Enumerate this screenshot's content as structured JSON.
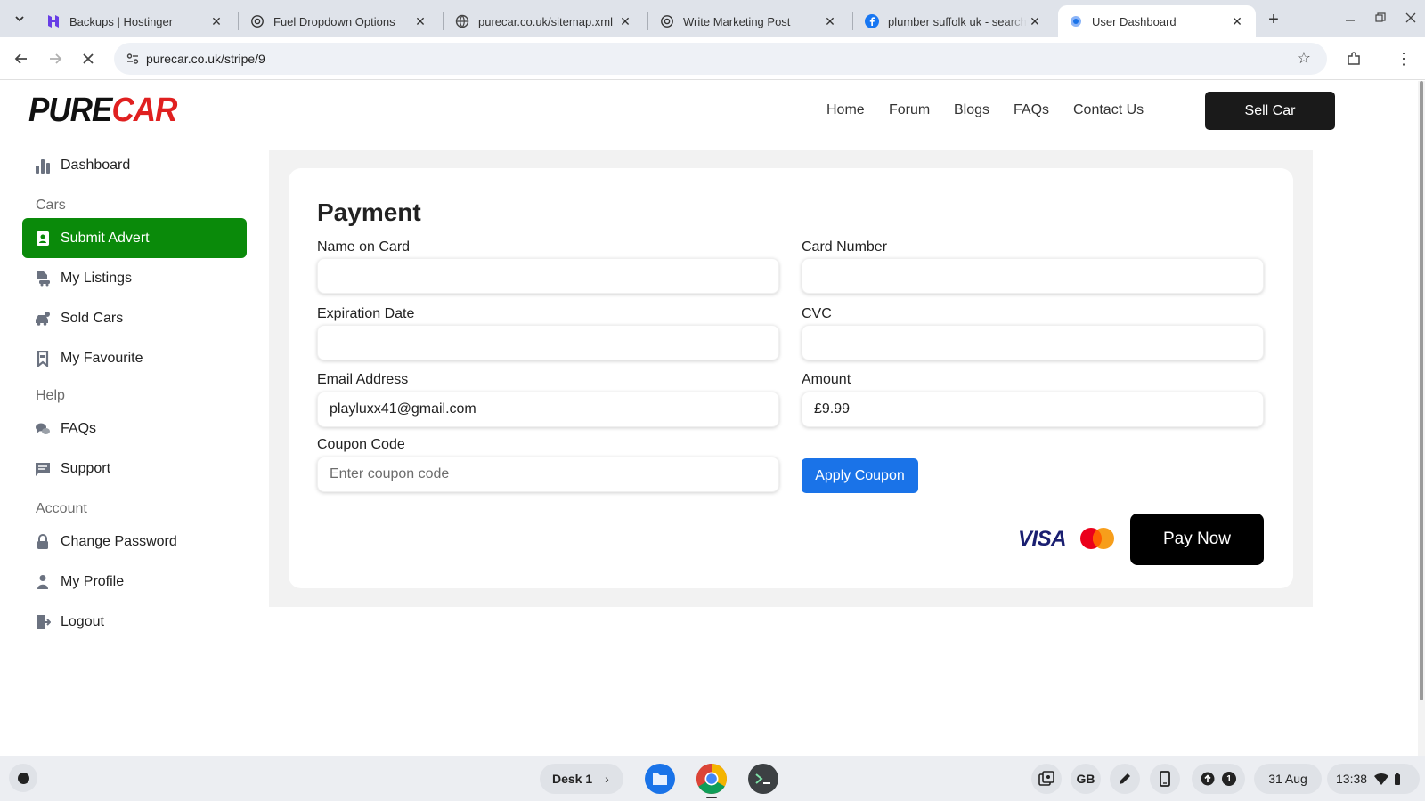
{
  "browser": {
    "tabs": [
      {
        "title": "Backups | Hostinger",
        "icon": "hostinger-icon"
      },
      {
        "title": "Fuel Dropdown Options",
        "icon": "openai-icon"
      },
      {
        "title": "purecar.co.uk/sitemap.xml",
        "icon": "globe-icon"
      },
      {
        "title": "Write Marketing Post",
        "icon": "openai-icon"
      },
      {
        "title": "plumber suffolk uk - search",
        "icon": "facebook-icon"
      },
      {
        "title": "User Dashboard",
        "icon": "page-icon",
        "active": true
      }
    ],
    "url": "purecar.co.uk/stripe/9"
  },
  "site": {
    "logo_part1": "PURE",
    "logo_part2": "CAR",
    "nav": [
      "Home",
      "Forum",
      "Blogs",
      "FAQs",
      "Contact Us"
    ],
    "cta": "Sell Car"
  },
  "sidebar": {
    "dashboard": "Dashboard",
    "cars_heading": "Cars",
    "submit_advert": "Submit Advert",
    "my_listings": "My Listings",
    "sold_cars": "Sold Cars",
    "my_favourite": "My Favourite",
    "help_heading": "Help",
    "faqs": "FAQs",
    "support": "Support",
    "account_heading": "Account",
    "change_password": "Change Password",
    "my_profile": "My Profile",
    "logout": "Logout"
  },
  "payment": {
    "title": "Payment",
    "name_label": "Name on Card",
    "name_value": "",
    "card_label": "Card Number",
    "card_value": "",
    "exp_label": "Expiration Date",
    "exp_value": "",
    "cvc_label": "CVC",
    "cvc_value": "",
    "email_label": "Email Address",
    "email_value": "playluxx41@gmail.com",
    "amount_label": "Amount",
    "amount_value": "£9.99",
    "coupon_label": "Coupon Code",
    "coupon_placeholder": "Enter coupon code",
    "apply_label": "Apply Coupon",
    "visa_text": "VISA",
    "pay_label": "Pay Now"
  },
  "shelf": {
    "desk": "Desk 1",
    "keyboard": "GB",
    "notifications": "1",
    "date": "31 Aug",
    "time": "13:38"
  },
  "colors": {
    "accent_green": "#0a8a0a",
    "logo_red": "#e02020",
    "apply_blue": "#1a73e8",
    "button_dark": "#1a1a1a"
  }
}
